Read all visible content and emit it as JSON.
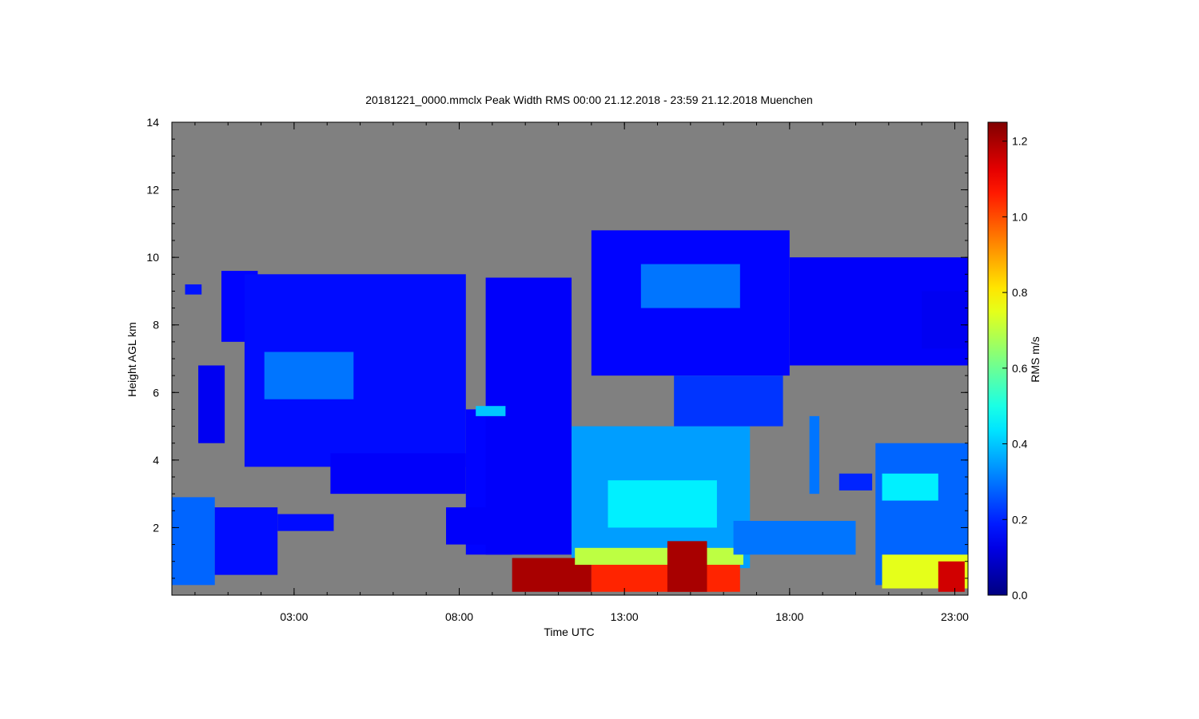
{
  "chart_data": {
    "type": "heatmap",
    "title": "20181221_0000.mmclx Peak Width RMS   00:00 21.12.2018 - 23:59 21.12.2018 Muenchen",
    "xlabel": "Time UTC",
    "ylabel": "Height AGL km",
    "colorbar_label": "RMS m/s",
    "x_unit": "hours UTC",
    "xlim": [
      -0.7,
      23.4
    ],
    "ylim": [
      0,
      14
    ],
    "x_ticks": [
      {
        "value": 3,
        "label": "03:00"
      },
      {
        "value": 8,
        "label": "08:00"
      },
      {
        "value": 13,
        "label": "13:00"
      },
      {
        "value": 18,
        "label": "18:00"
      },
      {
        "value": 23,
        "label": "23:00"
      }
    ],
    "y_ticks": [
      {
        "value": 2,
        "label": "2"
      },
      {
        "value": 4,
        "label": "4"
      },
      {
        "value": 6,
        "label": "6"
      },
      {
        "value": 8,
        "label": "8"
      },
      {
        "value": 10,
        "label": "10"
      },
      {
        "value": 12,
        "label": "12"
      },
      {
        "value": 14,
        "label": "14"
      }
    ],
    "colorbar": {
      "range": [
        0.0,
        1.25
      ],
      "ticks": [
        {
          "value": 0.0,
          "label": "0.0"
        },
        {
          "value": 0.2,
          "label": "0.2"
        },
        {
          "value": 0.4,
          "label": "0.4"
        },
        {
          "value": 0.6,
          "label": "0.6"
        },
        {
          "value": 0.8,
          "label": "0.8"
        },
        {
          "value": 1.0,
          "label": "1.0"
        },
        {
          "value": 1.2,
          "label": "1.2"
        }
      ],
      "colormap": "jet"
    },
    "background_color": "#808080",
    "regions": [
      {
        "t0": -0.3,
        "t1": 0.2,
        "h0": 8.9,
        "h1": 9.2,
        "value": 0.18
      },
      {
        "t0": 0.1,
        "t1": 0.9,
        "h0": 4.5,
        "h1": 6.8,
        "value": 0.14
      },
      {
        "t0": 0.8,
        "t1": 1.9,
        "h0": 7.5,
        "h1": 9.6,
        "value": 0.16
      },
      {
        "t0": 1.5,
        "t1": 8.2,
        "h0": 3.8,
        "h1": 9.5,
        "value": 0.17
      },
      {
        "t0": 2.1,
        "t1": 4.8,
        "h0": 5.8,
        "h1": 7.2,
        "value": 0.3
      },
      {
        "t0": 4.1,
        "t1": 8.2,
        "h0": 3.0,
        "h1": 4.2,
        "value": 0.15
      },
      {
        "t0": 8.2,
        "t1": 9.6,
        "h0": 1.2,
        "h1": 5.5,
        "value": 0.16
      },
      {
        "t0": 8.8,
        "t1": 11.4,
        "h0": 1.2,
        "h1": 9.4,
        "value": 0.15
      },
      {
        "t0": 8.5,
        "t1": 9.4,
        "h0": 5.3,
        "h1": 5.6,
        "value": 0.4
      },
      {
        "t0": 11.4,
        "t1": 16.8,
        "h0": 0.8,
        "h1": 5.0,
        "value": 0.35
      },
      {
        "t0": 12.5,
        "t1": 15.8,
        "h0": 2.0,
        "h1": 3.4,
        "value": 0.45
      },
      {
        "t0": 9.6,
        "t1": 12.0,
        "h0": 0.1,
        "h1": 1.1,
        "value": 1.2
      },
      {
        "t0": 12.0,
        "t1": 16.5,
        "h0": 0.1,
        "h1": 1.2,
        "value": 1.05
      },
      {
        "t0": 11.5,
        "t1": 16.6,
        "h0": 0.9,
        "h1": 1.4,
        "value": 0.7
      },
      {
        "t0": 14.3,
        "t1": 15.5,
        "h0": 0.1,
        "h1": 1.6,
        "value": 1.2
      },
      {
        "t0": 12.0,
        "t1": 18.0,
        "h0": 6.5,
        "h1": 10.8,
        "value": 0.16
      },
      {
        "t0": 13.5,
        "t1": 16.5,
        "h0": 8.5,
        "h1": 9.8,
        "value": 0.3
      },
      {
        "t0": 14.5,
        "t1": 17.8,
        "h0": 5.0,
        "h1": 6.5,
        "value": 0.22
      },
      {
        "t0": 18.0,
        "t1": 23.4,
        "h0": 6.8,
        "h1": 10.0,
        "value": 0.15
      },
      {
        "t0": 22.0,
        "t1": 23.4,
        "h0": 7.3,
        "h1": 9.0,
        "value": 0.14
      },
      {
        "t0": 16.3,
        "t1": 20.0,
        "h0": 1.2,
        "h1": 2.2,
        "value": 0.3
      },
      {
        "t0": 18.6,
        "t1": 18.9,
        "h0": 3.0,
        "h1": 5.3,
        "value": 0.3
      },
      {
        "t0": 19.5,
        "t1": 20.5,
        "h0": 3.1,
        "h1": 3.6,
        "value": 0.2
      },
      {
        "t0": 20.6,
        "t1": 23.4,
        "h0": 0.3,
        "h1": 4.5,
        "value": 0.28
      },
      {
        "t0": 20.8,
        "t1": 22.5,
        "h0": 2.8,
        "h1": 3.6,
        "value": 0.45
      },
      {
        "t0": 20.8,
        "t1": 23.4,
        "h0": 0.2,
        "h1": 1.2,
        "value": 0.75
      },
      {
        "t0": 22.5,
        "t1": 23.3,
        "h0": 0.1,
        "h1": 1.0,
        "value": 1.15
      },
      {
        "t0": -0.7,
        "t1": 0.6,
        "h0": 0.3,
        "h1": 2.9,
        "value": 0.28
      },
      {
        "t0": 0.6,
        "t1": 2.5,
        "h0": 0.6,
        "h1": 2.6,
        "value": 0.17
      },
      {
        "t0": 2.5,
        "t1": 4.2,
        "h0": 1.9,
        "h1": 2.4,
        "value": 0.17
      },
      {
        "t0": 7.6,
        "t1": 8.8,
        "h0": 1.5,
        "h1": 2.6,
        "value": 0.15
      }
    ]
  }
}
